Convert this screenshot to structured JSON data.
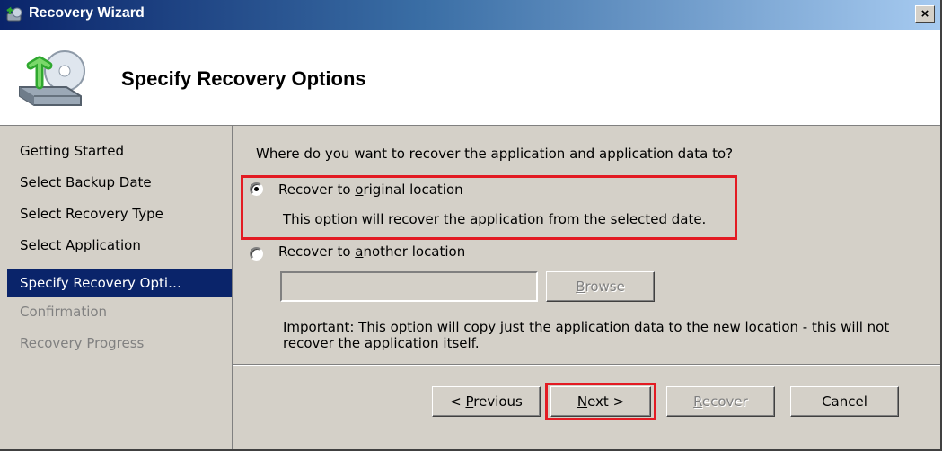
{
  "window": {
    "title": "Recovery Wizard",
    "close_label": "×"
  },
  "header": {
    "title": "Specify Recovery Options"
  },
  "steps": [
    {
      "label": "Getting Started",
      "state": "normal"
    },
    {
      "label": "Select Backup Date",
      "state": "normal"
    },
    {
      "label": "Select Recovery Type",
      "state": "normal"
    },
    {
      "label": "Select Application",
      "state": "normal"
    },
    {
      "label": "Specify Recovery Opti…",
      "state": "active"
    },
    {
      "label": "Confirmation",
      "state": "disabled"
    },
    {
      "label": "Recovery Progress",
      "state": "disabled"
    }
  ],
  "main": {
    "question": "Where do you want to recover the application and application data to?",
    "option_original": {
      "label_pre": "Recover to ",
      "label_accel": "o",
      "label_post": "riginal location",
      "description": "This option will recover the application from the selected date.",
      "selected": true
    },
    "option_another": {
      "label_pre": "Recover to ",
      "label_accel": "a",
      "label_post": "nother location",
      "selected": false
    },
    "location_input": {
      "value": "",
      "placeholder": ""
    },
    "browse_button": {
      "accel": "B",
      "rest": "rowse"
    },
    "important_note": "Important: This option will copy just the application data to the new location - this will not recover the application itself."
  },
  "buttons": {
    "previous": {
      "pre": "< ",
      "accel": "P",
      "rest": "revious"
    },
    "next": {
      "pre": "",
      "accel": "N",
      "rest": "ext >"
    },
    "recover": {
      "pre": "",
      "accel": "R",
      "rest": "ecover"
    },
    "cancel": {
      "label": "Cancel"
    }
  },
  "colors": {
    "highlight": "#e31b23",
    "active_step": "#0a246a",
    "dialog_bg": "#d4d0c8"
  }
}
